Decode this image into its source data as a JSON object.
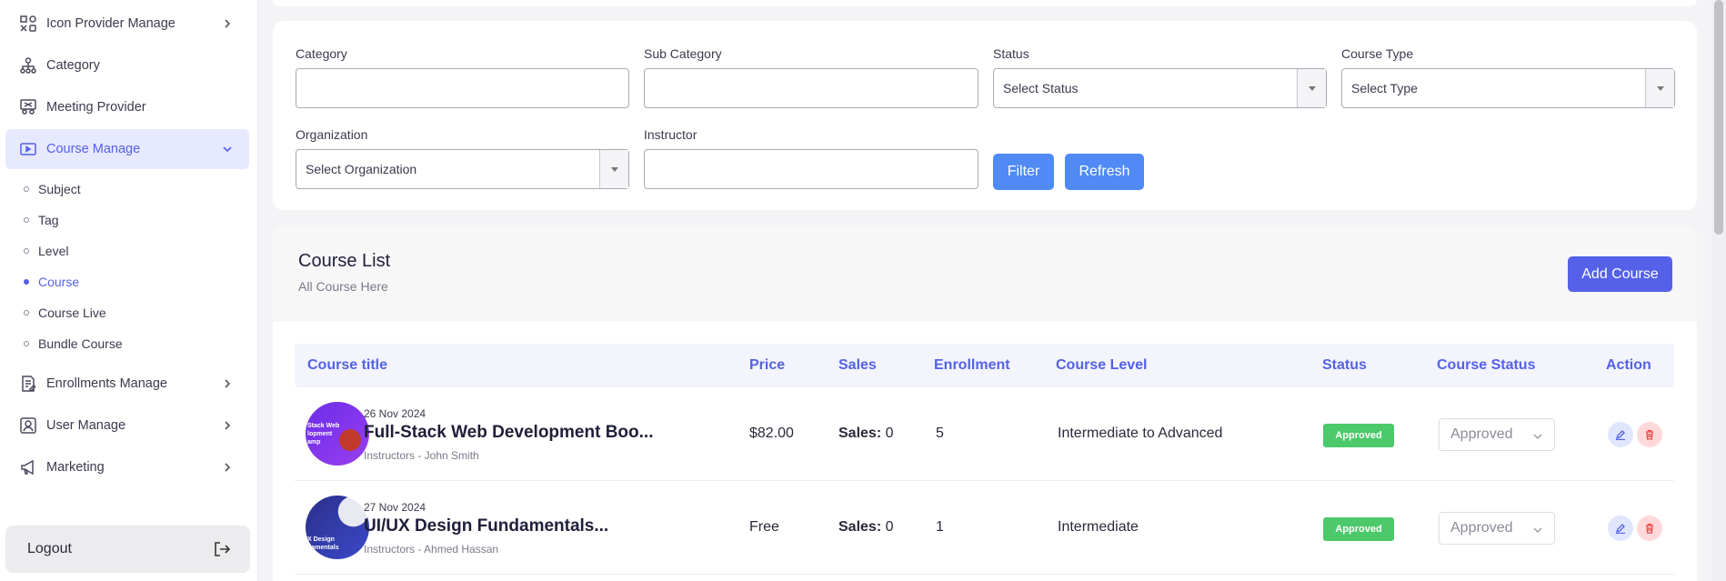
{
  "sidebar": {
    "items": [
      {
        "label": "Icon Provider Manage",
        "icon": "icon-grid-icon"
      },
      {
        "label": "Category",
        "icon": "hierarchy-icon"
      },
      {
        "label": "Meeting Provider",
        "icon": "meeting-icon"
      },
      {
        "label": "Course Manage",
        "icon": "video-icon"
      },
      {
        "label": "Enrollments Manage",
        "icon": "edit-list-icon"
      },
      {
        "label": "User Manage",
        "icon": "user-icon"
      },
      {
        "label": "Marketing",
        "icon": "megaphone-icon"
      }
    ],
    "sub_items": [
      "Subject",
      "Tag",
      "Level",
      "Course",
      "Course Live",
      "Bundle Course"
    ],
    "logout_label": "Logout"
  },
  "filters": {
    "category_label": "Category",
    "subcategory_label": "Sub Category",
    "status_label": "Status",
    "status_value": "Select Status",
    "course_type_label": "Course Type",
    "course_type_value": "Select Type",
    "organization_label": "Organization",
    "organization_value": "Select Organization",
    "instructor_label": "Instructor",
    "filter_button": "Filter",
    "refresh_button": "Refresh"
  },
  "course_list": {
    "title": "Course List",
    "subtitle": "All Course Here",
    "add_button": "Add Course",
    "columns": [
      "Course title",
      "Price",
      "Sales",
      "Enrollment",
      "Course Level",
      "Status",
      "Course Status",
      "Action"
    ],
    "rows": [
      {
        "date": "26 Nov 2024",
        "title": "Full-Stack Web Development Boo...",
        "instructor": "Instructors - John Smith",
        "thumb_text": "Stack Web lopment amp",
        "price": "$82.00",
        "sales_label": "Sales:",
        "sales_value": "0",
        "enrollment": "5",
        "level": "Intermediate to Advanced",
        "status": "Approved",
        "course_status": "Approved"
      },
      {
        "date": "27 Nov 2024",
        "title": "UI/UX Design Fundamentals...",
        "instructor": "Instructors - Ahmed Hassan",
        "thumb_text": "X Design damentals",
        "price": "Free",
        "sales_label": "Sales:",
        "sales_value": "0",
        "enrollment": "1",
        "level": "Intermediate",
        "status": "Approved",
        "course_status": "Approved"
      }
    ]
  },
  "colors": {
    "accent": "#5461e8",
    "filter_button": "#4f8af5",
    "approved_badge": "#4cc96a",
    "delete": "#f04848"
  }
}
